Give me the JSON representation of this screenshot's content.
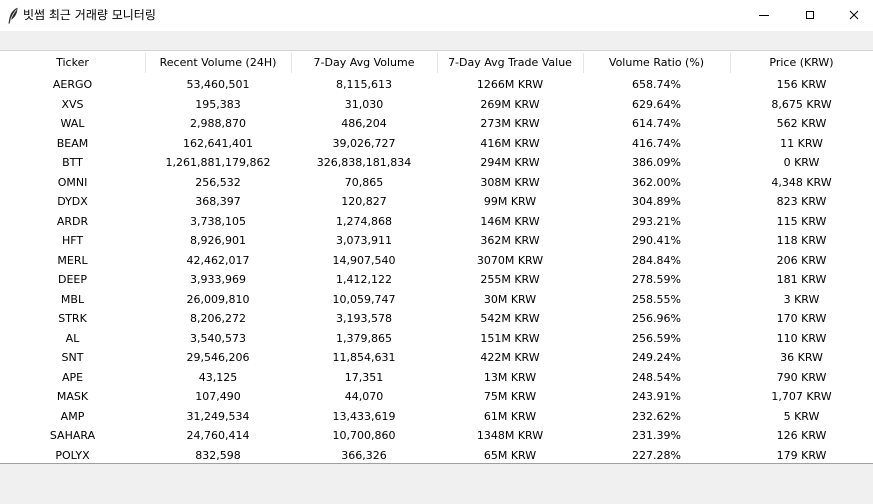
{
  "window": {
    "title": "빗썸 최근 거래량 모니터링",
    "icon": "feather-icon"
  },
  "table": {
    "columns": [
      "Ticker",
      "Recent Volume (24H)",
      "7-Day Avg Volume",
      "7-Day Avg Trade Value",
      "Volume Ratio (%)",
      "Price (KRW)"
    ],
    "rows": [
      [
        "AERGO",
        "53,460,501",
        "8,115,613",
        "1266M KRW",
        "658.74%",
        "156 KRW"
      ],
      [
        "XVS",
        "195,383",
        "31,030",
        "269M KRW",
        "629.64%",
        "8,675 KRW"
      ],
      [
        "WAL",
        "2,988,870",
        "486,204",
        "273M KRW",
        "614.74%",
        "562 KRW"
      ],
      [
        "BEAM",
        "162,641,401",
        "39,026,727",
        "416M KRW",
        "416.74%",
        "11 KRW"
      ],
      [
        "BTT",
        "1,261,881,179,862",
        "326,838,181,834",
        "294M KRW",
        "386.09%",
        "0 KRW"
      ],
      [
        "OMNI",
        "256,532",
        "70,865",
        "308M KRW",
        "362.00%",
        "4,348 KRW"
      ],
      [
        "DYDX",
        "368,397",
        "120,827",
        "99M KRW",
        "304.89%",
        "823 KRW"
      ],
      [
        "ARDR",
        "3,738,105",
        "1,274,868",
        "146M KRW",
        "293.21%",
        "115 KRW"
      ],
      [
        "HFT",
        "8,926,901",
        "3,073,911",
        "362M KRW",
        "290.41%",
        "118 KRW"
      ],
      [
        "MERL",
        "42,462,017",
        "14,907,540",
        "3070M KRW",
        "284.84%",
        "206 KRW"
      ],
      [
        "DEEP",
        "3,933,969",
        "1,412,122",
        "255M KRW",
        "278.59%",
        "181 KRW"
      ],
      [
        "MBL",
        "26,009,810",
        "10,059,747",
        "30M KRW",
        "258.55%",
        "3 KRW"
      ],
      [
        "STRK",
        "8,206,272",
        "3,193,578",
        "542M KRW",
        "256.96%",
        "170 KRW"
      ],
      [
        "AL",
        "3,540,573",
        "1,379,865",
        "151M KRW",
        "256.59%",
        "110 KRW"
      ],
      [
        "SNT",
        "29,546,206",
        "11,854,631",
        "422M KRW",
        "249.24%",
        "36 KRW"
      ],
      [
        "APE",
        "43,125",
        "17,351",
        "13M KRW",
        "248.54%",
        "790 KRW"
      ],
      [
        "MASK",
        "107,490",
        "44,070",
        "75M KRW",
        "243.91%",
        "1,707 KRW"
      ],
      [
        "AMP",
        "31,249,534",
        "13,433,619",
        "61M KRW",
        "232.62%",
        "5 KRW"
      ],
      [
        "SAHARA",
        "24,760,414",
        "10,700,860",
        "1348M KRW",
        "231.39%",
        "126 KRW"
      ],
      [
        "POLYX",
        "832,598",
        "366,326",
        "65M KRW",
        "227.28%",
        "179 KRW"
      ]
    ]
  }
}
